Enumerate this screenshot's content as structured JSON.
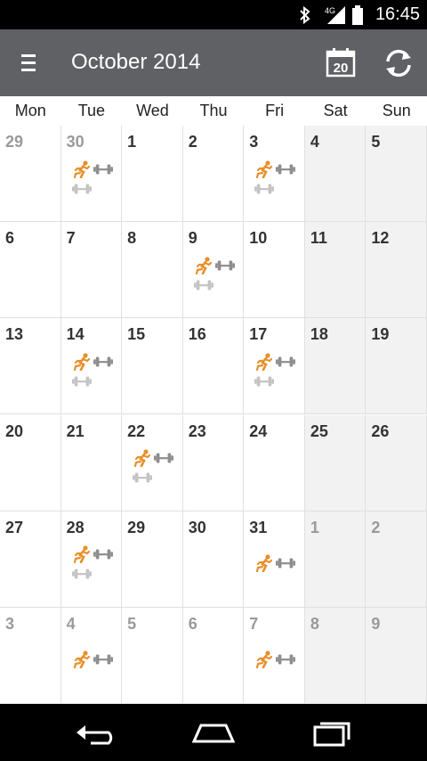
{
  "status": {
    "time": "16:45",
    "network": "4G"
  },
  "app": {
    "title": "October 2014",
    "today_day": "20"
  },
  "weekdays": [
    "Mon",
    "Tue",
    "Wed",
    "Thu",
    "Fri",
    "Sat",
    "Sun"
  ],
  "weeks": [
    [
      {
        "d": "29",
        "o": true,
        "a": []
      },
      {
        "d": "30",
        "o": true,
        "a": [
          "run",
          "dumb"
        ]
      },
      {
        "d": "1",
        "a": []
      },
      {
        "d": "2",
        "a": []
      },
      {
        "d": "3",
        "a": [
          "run",
          "dumb"
        ]
      },
      {
        "d": "4",
        "w": true,
        "a": []
      },
      {
        "d": "5",
        "w": true,
        "a": []
      }
    ],
    [
      {
        "d": "6",
        "a": []
      },
      {
        "d": "7",
        "a": []
      },
      {
        "d": "8",
        "a": []
      },
      {
        "d": "9",
        "a": [
          "run",
          "dumb"
        ]
      },
      {
        "d": "10",
        "a": []
      },
      {
        "d": "11",
        "w": true,
        "a": []
      },
      {
        "d": "12",
        "w": true,
        "a": []
      }
    ],
    [
      {
        "d": "13",
        "a": []
      },
      {
        "d": "14",
        "a": [
          "run",
          "dumb"
        ]
      },
      {
        "d": "15",
        "a": []
      },
      {
        "d": "16",
        "a": []
      },
      {
        "d": "17",
        "a": [
          "run",
          "dumb"
        ]
      },
      {
        "d": "18",
        "w": true,
        "a": []
      },
      {
        "d": "19",
        "w": true,
        "a": []
      }
    ],
    [
      {
        "d": "20",
        "a": []
      },
      {
        "d": "21",
        "a": []
      },
      {
        "d": "22",
        "a": [
          "run",
          "dumb"
        ]
      },
      {
        "d": "23",
        "a": []
      },
      {
        "d": "24",
        "a": []
      },
      {
        "d": "25",
        "w": true,
        "a": []
      },
      {
        "d": "26",
        "w": true,
        "a": []
      }
    ],
    [
      {
        "d": "27",
        "a": []
      },
      {
        "d": "28",
        "a": [
          "run",
          "dumb"
        ]
      },
      {
        "d": "29",
        "a": []
      },
      {
        "d": "30",
        "a": []
      },
      {
        "d": "31",
        "a": [
          "run"
        ]
      },
      {
        "d": "1",
        "o": true,
        "w": true,
        "a": []
      },
      {
        "d": "2",
        "o": true,
        "w": true,
        "a": []
      }
    ],
    [
      {
        "d": "3",
        "o": true,
        "a": []
      },
      {
        "d": "4",
        "o": true,
        "a": [
          "run"
        ]
      },
      {
        "d": "5",
        "o": true,
        "a": []
      },
      {
        "d": "6",
        "o": true,
        "a": []
      },
      {
        "d": "7",
        "o": true,
        "a": [
          "run"
        ]
      },
      {
        "d": "8",
        "o": true,
        "w": true,
        "a": []
      },
      {
        "d": "9",
        "o": true,
        "w": true,
        "a": []
      }
    ]
  ],
  "icons": {
    "runner": "runner-icon",
    "dumbbell": "dumbbell-icon"
  },
  "colors": {
    "appbar": "#5f6164",
    "runner": "#e8902a",
    "dumbbell": "#8e8e8e",
    "dumbbell_light": "#c4c4c4"
  }
}
